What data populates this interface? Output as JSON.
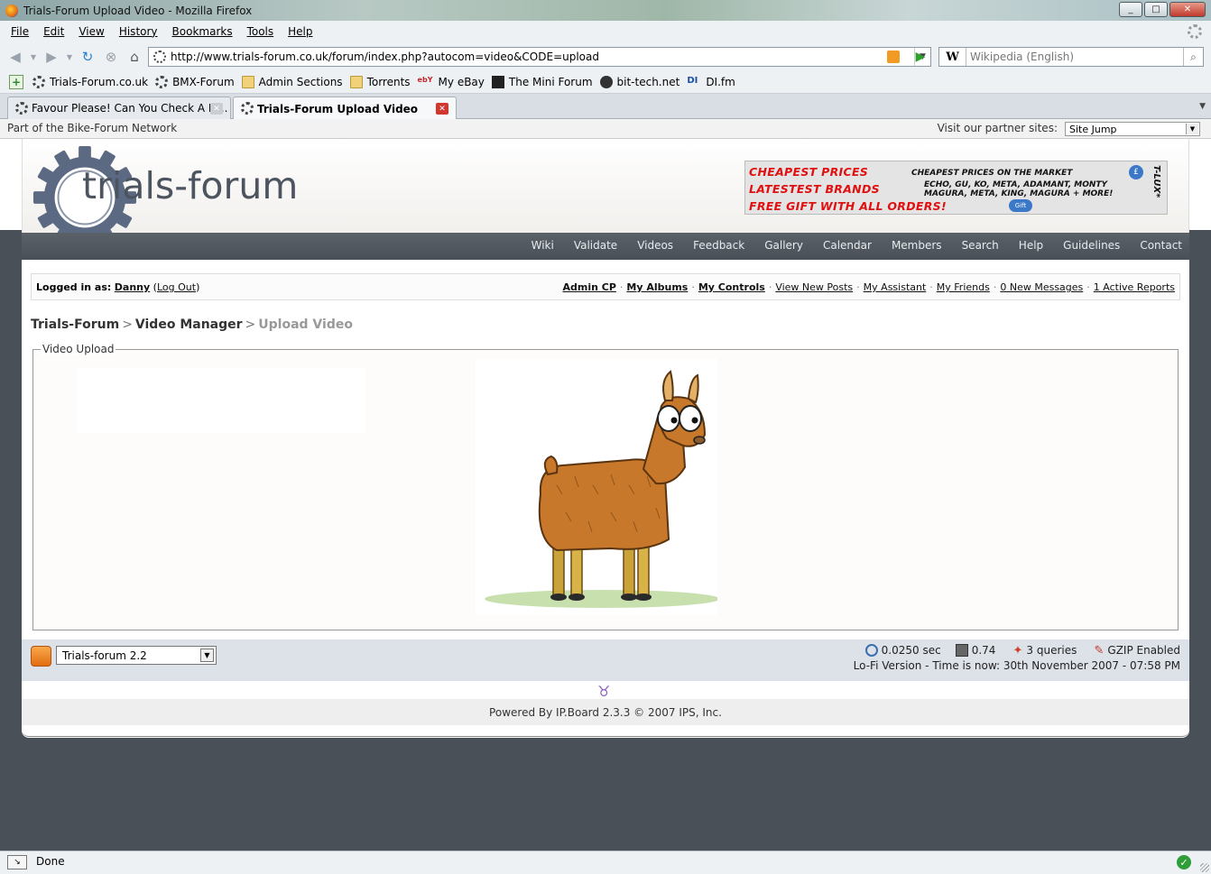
{
  "window": {
    "title": "Trials-Forum Upload Video - Mozilla Firefox",
    "buttons": [
      "_",
      "□",
      "✕"
    ]
  },
  "menu": [
    "File",
    "Edit",
    "View",
    "History",
    "Bookmarks",
    "Tools",
    "Help"
  ],
  "nav": {
    "url": "http://www.trials-forum.co.uk/forum/index.php?autocom=video&CODE=upload",
    "search_engine": "W",
    "search_placeholder": "Wikipedia (English)"
  },
  "bookmarks": [
    {
      "label": "Trials-Forum.co.uk",
      "icon": "gear-icon"
    },
    {
      "label": "BMX-Forum",
      "icon": "gear-icon"
    },
    {
      "label": "Admin Sections",
      "icon": "folder-icon"
    },
    {
      "label": "Torrents",
      "icon": "folder-icon"
    },
    {
      "label": "My eBay",
      "icon": "ebay-icon"
    },
    {
      "label": "The Mini Forum",
      "icon": "mini-icon"
    },
    {
      "label": "bit-tech.net",
      "icon": "net-icon"
    },
    {
      "label": "DI.fm",
      "icon": "di-icon"
    }
  ],
  "tabs": [
    {
      "label": "Favour Please! Can You Check A Li...",
      "active": false
    },
    {
      "label": "Trials-Forum Upload Video",
      "active": true
    }
  ],
  "page": {
    "network_text": "Part of the Bike-Forum Network",
    "partner_label": "Visit our partner sites:",
    "site_jump": "Site Jump",
    "logo_text": "trials-forum",
    "banner": {
      "line1": "CHEAPEST PRICES",
      "line1_sub": "CHEAPEST PRICES ON THE MARKET",
      "line2": "LATESTEST BRANDS",
      "line2_sub1": "ECHO, GU, KO, META, ADAMANT, MONTY",
      "line2_sub2": "MAGURA, META, KING, MAGURA + MORE!",
      "line3": "FREE GIFT WITH ALL ORDERS!",
      "brand": "T-LUX*",
      "pound": "£",
      "gift": "Gift"
    },
    "nav_links": [
      "Wiki",
      "Validate",
      "Videos",
      "Feedback",
      "Gallery",
      "Calendar",
      "Members",
      "Search",
      "Help",
      "Guidelines",
      "Contact"
    ],
    "user": {
      "logged_label": "Logged in as:",
      "name": "Danny",
      "logout": "Log Out",
      "links": [
        "Admin CP",
        "My Albums",
        "My Controls",
        "View New Posts",
        "My Assistant",
        "My Friends",
        "0 New Messages",
        "1 Active Reports"
      ]
    },
    "breadcrumb": [
      "Trials-Forum",
      "Video Manager",
      "Upload Video"
    ],
    "fieldset_legend": "Video Upload",
    "footer": {
      "skin": "Trials-forum 2.2",
      "time_sec": "0.0250 sec",
      "load": "0.74",
      "queries": "3 queries",
      "gzip": "GZIP Enabled",
      "lofi": "Lo-Fi Version",
      "time_now": "Time is now: 30th November 2007 - 07:58 PM",
      "powered": "Powered By IP.Board 2.3.3 © 2007  IPS, Inc."
    }
  },
  "status": {
    "text": "Done"
  },
  "colors": {
    "page_bg": "#4a5058",
    "nav_strip": "#50565e",
    "footer_bar": "#dde1e8",
    "banner_red": "#e01010"
  }
}
